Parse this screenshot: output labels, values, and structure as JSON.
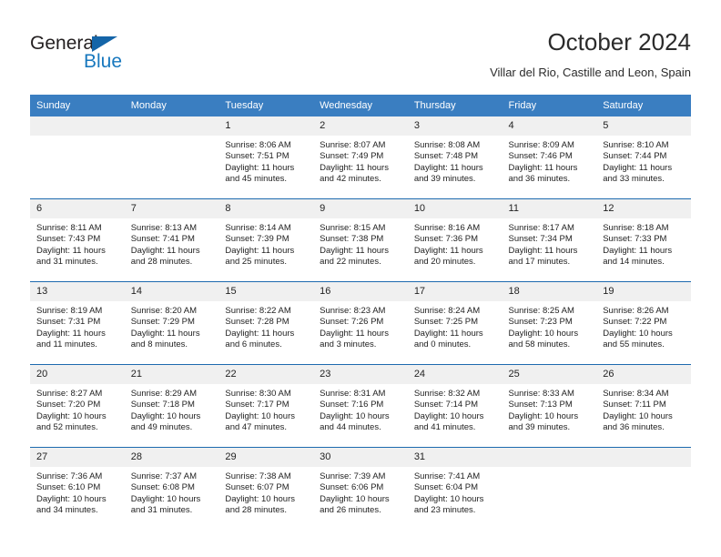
{
  "logo": {
    "word1": "General",
    "word2": "Blue",
    "triangle_color": "#1565a8",
    "word2_color": "#1878be"
  },
  "header": {
    "title": "October 2024",
    "subtitle": "Villar del Rio, Castille and Leon, Spain"
  },
  "theme": {
    "header_bg": "#3a7ec1",
    "row_separator": "#1d6aaf",
    "daynum_bg": "#f0f0f0"
  },
  "weekdays": [
    "Sunday",
    "Monday",
    "Tuesday",
    "Wednesday",
    "Thursday",
    "Friday",
    "Saturday"
  ],
  "weeks": [
    [
      {
        "day": "",
        "blank": true,
        "sunrise": "",
        "sunset": "",
        "daylight1": "",
        "daylight2": ""
      },
      {
        "day": "",
        "blank": true,
        "sunrise": "",
        "sunset": "",
        "daylight1": "",
        "daylight2": ""
      },
      {
        "day": "1",
        "sunrise": "Sunrise: 8:06 AM",
        "sunset": "Sunset: 7:51 PM",
        "daylight1": "Daylight: 11 hours",
        "daylight2": "and 45 minutes."
      },
      {
        "day": "2",
        "sunrise": "Sunrise: 8:07 AM",
        "sunset": "Sunset: 7:49 PM",
        "daylight1": "Daylight: 11 hours",
        "daylight2": "and 42 minutes."
      },
      {
        "day": "3",
        "sunrise": "Sunrise: 8:08 AM",
        "sunset": "Sunset: 7:48 PM",
        "daylight1": "Daylight: 11 hours",
        "daylight2": "and 39 minutes."
      },
      {
        "day": "4",
        "sunrise": "Sunrise: 8:09 AM",
        "sunset": "Sunset: 7:46 PM",
        "daylight1": "Daylight: 11 hours",
        "daylight2": "and 36 minutes."
      },
      {
        "day": "5",
        "sunrise": "Sunrise: 8:10 AM",
        "sunset": "Sunset: 7:44 PM",
        "daylight1": "Daylight: 11 hours",
        "daylight2": "and 33 minutes."
      }
    ],
    [
      {
        "day": "6",
        "sunrise": "Sunrise: 8:11 AM",
        "sunset": "Sunset: 7:43 PM",
        "daylight1": "Daylight: 11 hours",
        "daylight2": "and 31 minutes."
      },
      {
        "day": "7",
        "sunrise": "Sunrise: 8:13 AM",
        "sunset": "Sunset: 7:41 PM",
        "daylight1": "Daylight: 11 hours",
        "daylight2": "and 28 minutes."
      },
      {
        "day": "8",
        "sunrise": "Sunrise: 8:14 AM",
        "sunset": "Sunset: 7:39 PM",
        "daylight1": "Daylight: 11 hours",
        "daylight2": "and 25 minutes."
      },
      {
        "day": "9",
        "sunrise": "Sunrise: 8:15 AM",
        "sunset": "Sunset: 7:38 PM",
        "daylight1": "Daylight: 11 hours",
        "daylight2": "and 22 minutes."
      },
      {
        "day": "10",
        "sunrise": "Sunrise: 8:16 AM",
        "sunset": "Sunset: 7:36 PM",
        "daylight1": "Daylight: 11 hours",
        "daylight2": "and 20 minutes."
      },
      {
        "day": "11",
        "sunrise": "Sunrise: 8:17 AM",
        "sunset": "Sunset: 7:34 PM",
        "daylight1": "Daylight: 11 hours",
        "daylight2": "and 17 minutes."
      },
      {
        "day": "12",
        "sunrise": "Sunrise: 8:18 AM",
        "sunset": "Sunset: 7:33 PM",
        "daylight1": "Daylight: 11 hours",
        "daylight2": "and 14 minutes."
      }
    ],
    [
      {
        "day": "13",
        "sunrise": "Sunrise: 8:19 AM",
        "sunset": "Sunset: 7:31 PM",
        "daylight1": "Daylight: 11 hours",
        "daylight2": "and 11 minutes."
      },
      {
        "day": "14",
        "sunrise": "Sunrise: 8:20 AM",
        "sunset": "Sunset: 7:29 PM",
        "daylight1": "Daylight: 11 hours",
        "daylight2": "and 8 minutes."
      },
      {
        "day": "15",
        "sunrise": "Sunrise: 8:22 AM",
        "sunset": "Sunset: 7:28 PM",
        "daylight1": "Daylight: 11 hours",
        "daylight2": "and 6 minutes."
      },
      {
        "day": "16",
        "sunrise": "Sunrise: 8:23 AM",
        "sunset": "Sunset: 7:26 PM",
        "daylight1": "Daylight: 11 hours",
        "daylight2": "and 3 minutes."
      },
      {
        "day": "17",
        "sunrise": "Sunrise: 8:24 AM",
        "sunset": "Sunset: 7:25 PM",
        "daylight1": "Daylight: 11 hours",
        "daylight2": "and 0 minutes."
      },
      {
        "day": "18",
        "sunrise": "Sunrise: 8:25 AM",
        "sunset": "Sunset: 7:23 PM",
        "daylight1": "Daylight: 10 hours",
        "daylight2": "and 58 minutes."
      },
      {
        "day": "19",
        "sunrise": "Sunrise: 8:26 AM",
        "sunset": "Sunset: 7:22 PM",
        "daylight1": "Daylight: 10 hours",
        "daylight2": "and 55 minutes."
      }
    ],
    [
      {
        "day": "20",
        "sunrise": "Sunrise: 8:27 AM",
        "sunset": "Sunset: 7:20 PM",
        "daylight1": "Daylight: 10 hours",
        "daylight2": "and 52 minutes."
      },
      {
        "day": "21",
        "sunrise": "Sunrise: 8:29 AM",
        "sunset": "Sunset: 7:18 PM",
        "daylight1": "Daylight: 10 hours",
        "daylight2": "and 49 minutes."
      },
      {
        "day": "22",
        "sunrise": "Sunrise: 8:30 AM",
        "sunset": "Sunset: 7:17 PM",
        "daylight1": "Daylight: 10 hours",
        "daylight2": "and 47 minutes."
      },
      {
        "day": "23",
        "sunrise": "Sunrise: 8:31 AM",
        "sunset": "Sunset: 7:16 PM",
        "daylight1": "Daylight: 10 hours",
        "daylight2": "and 44 minutes."
      },
      {
        "day": "24",
        "sunrise": "Sunrise: 8:32 AM",
        "sunset": "Sunset: 7:14 PM",
        "daylight1": "Daylight: 10 hours",
        "daylight2": "and 41 minutes."
      },
      {
        "day": "25",
        "sunrise": "Sunrise: 8:33 AM",
        "sunset": "Sunset: 7:13 PM",
        "daylight1": "Daylight: 10 hours",
        "daylight2": "and 39 minutes."
      },
      {
        "day": "26",
        "sunrise": "Sunrise: 8:34 AM",
        "sunset": "Sunset: 7:11 PM",
        "daylight1": "Daylight: 10 hours",
        "daylight2": "and 36 minutes."
      }
    ],
    [
      {
        "day": "27",
        "sunrise": "Sunrise: 7:36 AM",
        "sunset": "Sunset: 6:10 PM",
        "daylight1": "Daylight: 10 hours",
        "daylight2": "and 34 minutes."
      },
      {
        "day": "28",
        "sunrise": "Sunrise: 7:37 AM",
        "sunset": "Sunset: 6:08 PM",
        "daylight1": "Daylight: 10 hours",
        "daylight2": "and 31 minutes."
      },
      {
        "day": "29",
        "sunrise": "Sunrise: 7:38 AM",
        "sunset": "Sunset: 6:07 PM",
        "daylight1": "Daylight: 10 hours",
        "daylight2": "and 28 minutes."
      },
      {
        "day": "30",
        "sunrise": "Sunrise: 7:39 AM",
        "sunset": "Sunset: 6:06 PM",
        "daylight1": "Daylight: 10 hours",
        "daylight2": "and 26 minutes."
      },
      {
        "day": "31",
        "sunrise": "Sunrise: 7:41 AM",
        "sunset": "Sunset: 6:04 PM",
        "daylight1": "Daylight: 10 hours",
        "daylight2": "and 23 minutes."
      },
      {
        "day": "",
        "blank": true,
        "sunrise": "",
        "sunset": "",
        "daylight1": "",
        "daylight2": ""
      },
      {
        "day": "",
        "blank": true,
        "sunrise": "",
        "sunset": "",
        "daylight1": "",
        "daylight2": ""
      }
    ]
  ]
}
